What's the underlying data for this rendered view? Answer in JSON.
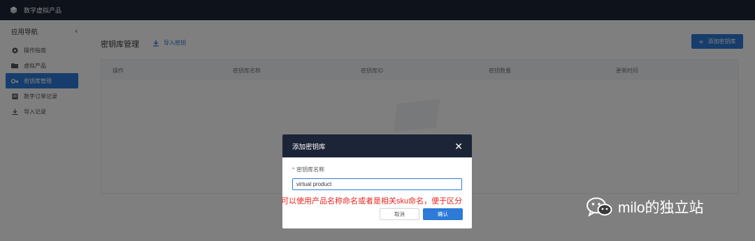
{
  "app": {
    "title": "数字虚拟产品"
  },
  "sidebar": {
    "header": "应用导航",
    "collapse_glyph": "‹",
    "items": [
      {
        "label": "操作指南",
        "icon": "guide-icon",
        "active": false
      },
      {
        "label": "虚拟产品",
        "icon": "folder-icon",
        "active": false
      },
      {
        "label": "密钥库管理",
        "icon": "key-icon",
        "active": true
      },
      {
        "label": "数字订单记录",
        "icon": "order-icon",
        "active": false
      },
      {
        "label": "导入记录",
        "icon": "download-icon",
        "active": false
      }
    ]
  },
  "main": {
    "title": "密钥库管理",
    "import_label": "导入密钥",
    "add_label": "添加密钥库",
    "columns": [
      "操作",
      "密钥库名称",
      "密钥库ID",
      "密钥数量",
      "更新时间"
    ]
  },
  "dialog": {
    "title": "添加密钥库",
    "close_glyph": "✕",
    "field_label": "密钥库名称",
    "required_mark": "*",
    "input_value": "virtual product",
    "cancel_label": "取消",
    "confirm_label": "确认"
  },
  "annotation": "可以使用产品名称命名或者是相关sku命名，便于区分",
  "watermark": {
    "text": "milo的独立站",
    "icon": "wechat-icon"
  },
  "colors": {
    "nav_dark": "#1c2437",
    "accent": "#2d7ad7",
    "annotation_red": "#e8231f"
  }
}
